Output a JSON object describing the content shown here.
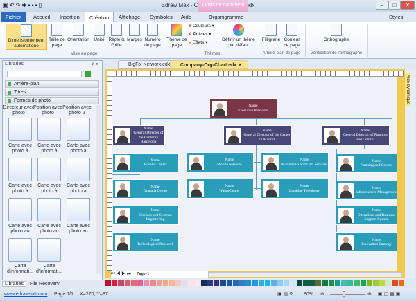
{
  "window": {
    "title": "Edraw Max - Company-Org-Chart.edx",
    "context_tab": "Outils de document",
    "styles": "Styles"
  },
  "tabs": [
    "Fichier",
    "Accueil",
    "Insertion",
    "Création",
    "Affichage",
    "Symboles",
    "Aide",
    "Organigramme"
  ],
  "ribbon": {
    "buttons": [
      {
        "label": "Dimensionnement automatique",
        "icon": "auto-size-icon"
      },
      {
        "label": "Taille de page",
        "icon": "page-size-icon"
      },
      {
        "label": "Orientation",
        "icon": "orientation-icon"
      },
      {
        "label": "Unité",
        "icon": "unit-icon"
      },
      {
        "label": "Règle & Grille",
        "icon": "grid-icon"
      },
      {
        "label": "Marges",
        "icon": "margins-icon"
      },
      {
        "label": "Numéro de page",
        "icon": "page-number-icon"
      },
      {
        "label": "Thème de page",
        "icon": "theme-icon"
      },
      {
        "label": "Définir un thème par défaut",
        "icon": "default-theme-icon"
      },
      {
        "label": "Filligrane",
        "icon": "watermark-icon"
      },
      {
        "label": "Couleur de page",
        "icon": "page-color-icon"
      },
      {
        "label": "Orthographe",
        "icon": "spelling-icon"
      }
    ],
    "small": [
      "Couleurs",
      "Polices",
      "Effets"
    ],
    "groups": [
      "Mise en page",
      "Thèmes",
      "Arrière-plan de page",
      "Vérification de l'orthographe"
    ]
  },
  "libraries": {
    "title": "Libraries",
    "categories": [
      "Arrière-plan",
      "Titres",
      "Formes de photo"
    ],
    "top_labels": [
      "Directeur avec photo",
      "Position avec photo",
      "Position avec photo 2"
    ],
    "items": [
      "Carte avec photo à",
      "Carte avec photo à",
      "Carte avec photo à",
      "Carte avec photo à",
      "Carte avec photo à",
      "Carte avec photo à",
      "Carte avec photo au",
      "Carte avec photo au",
      "Carte avec photo au",
      "Carte d'informati...",
      "Carte d'informati..."
    ],
    "bottom_tabs": [
      "Libraries",
      "File Recovery"
    ]
  },
  "documents": [
    "BigFix Network.edx",
    "Company-Org-Chart.edx"
  ],
  "right_panel": "Aide dynamique",
  "ruler_h": [
    "40",
    "60",
    "80",
    "100",
    "120",
    "140",
    "160",
    "180",
    "200",
    "220",
    "240",
    "260"
  ],
  "org": {
    "top": {
      "name": "Name",
      "role": "Executive President"
    },
    "level2": [
      {
        "name": "Name",
        "role": "General Director of the Center in Barcelona"
      },
      {
        "name": "Name",
        "role": "General Director of the Center in Madrid"
      },
      {
        "name": "Name",
        "role": "General Director of Planning and Control"
      }
    ],
    "left": [
      {
        "name": "Name",
        "role": "Bosello Center"
      },
      {
        "name": "Name",
        "role": "Granada Center"
      },
      {
        "name": "Name",
        "role": "Services and Systems Engineering"
      },
      {
        "name": "Name",
        "role": "Technological Research"
      }
    ],
    "mid_a": [
      {
        "name": "Name",
        "role": "Mobile Services"
      },
      {
        "name": "Name",
        "role": "Walqa Center"
      }
    ],
    "mid_b": [
      {
        "name": "Name",
        "role": "Multimedia and Data Services"
      },
      {
        "name": "Name",
        "role": "Landline Telephony"
      }
    ],
    "right": [
      {
        "name": "Name",
        "role": "Planning and Control"
      },
      {
        "name": "Name",
        "role": "Infrastructure Management"
      },
      {
        "name": "Name",
        "role": "Operations and Business Support System"
      },
      {
        "name": "Name",
        "role": "Innovation Strategy"
      }
    ]
  },
  "page_tab": "Page-1",
  "palette": [
    "#c0102a",
    "#d81e3a",
    "#c8456a",
    "#e05a6a",
    "#e86a7a",
    "#e0609a",
    "#e890b0",
    "#f08a8a",
    "#f4a0a0",
    "#f8a878",
    "#f4b8a0",
    "#f8c8c0",
    "#f0d8e8",
    "#fce0ea",
    "#fbe8ee",
    "#1a2a5a",
    "#2a3a7a",
    "#3a2a7a",
    "#1a4a8a",
    "#1a5aa0",
    "#2a6ab0",
    "#3a7ac0",
    "#2a8ad0",
    "#1a9ae0",
    "#3aaae0",
    "#10b8f0",
    "#60b0e0",
    "#90c8f0",
    "#a8d8f0",
    "#d0e8f8",
    "#0a4a3a",
    "#106040",
    "#105a50",
    "#5a6a30",
    "#107a40",
    "#20904a",
    "#10a090",
    "#50b8b0",
    "#30c0a0",
    "#40b870",
    "#10a850",
    "#80b820",
    "#a0c840",
    "#c0d840",
    "#d8e8c8",
    "#e04a20",
    "#f06a10"
  ],
  "status": {
    "link": "www.edrawsoft.com",
    "page": "Page 1/1",
    "coords": "X=270, Y=87",
    "zoom": "80%",
    "zoom_level": 0.4
  }
}
